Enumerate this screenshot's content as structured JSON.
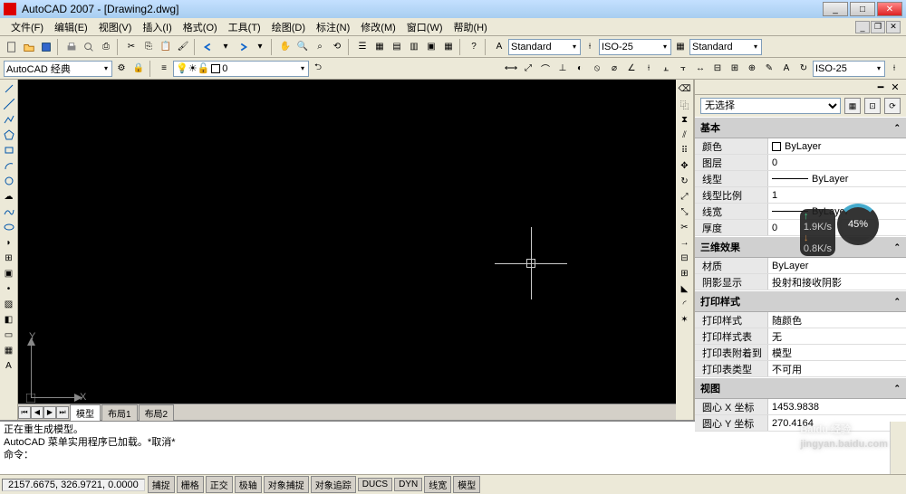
{
  "title": "AutoCAD 2007 - [Drawing2.dwg]",
  "menu": [
    "文件(F)",
    "编辑(E)",
    "视图(V)",
    "插入(I)",
    "格式(O)",
    "工具(T)",
    "绘图(D)",
    "标注(N)",
    "修改(M)",
    "窗口(W)",
    "帮助(H)"
  ],
  "workspace_combo": "AutoCAD 经典",
  "layer_combo": "0",
  "style1": "Standard",
  "style2": "ISO-25",
  "style3": "Standard",
  "style4": "ISO-25",
  "model_tabs": {
    "active": "模型",
    "inactive": [
      "布局1",
      "布局2"
    ]
  },
  "cmd": {
    "line1": "正在重生成模型。",
    "line2": "AutoCAD 菜单实用程序已加载。*取消*",
    "line3": "命令："
  },
  "status": {
    "coord": "2157.6675, 326.9721, 0.0000",
    "buttons": [
      "捕捉",
      "栅格",
      "正交",
      "极轴",
      "对象捕捉",
      "对象追踪",
      "DUCS",
      "DYN",
      "线宽",
      "模型"
    ]
  },
  "props": {
    "selector": "无选择",
    "groups": {
      "basic": {
        "title": "基本",
        "color_k": "颜色",
        "color_v": "ByLayer",
        "layer_k": "图层",
        "layer_v": "0",
        "ltype_k": "线型",
        "ltype_v": "ByLayer",
        "lscale_k": "线型比例",
        "lscale_v": "1",
        "lweight_k": "线宽",
        "lweight_v": "ByLayer",
        "thick_k": "厚度",
        "thick_v": "0"
      },
      "threed": {
        "title": "三维效果",
        "mat_k": "材质",
        "mat_v": "ByLayer",
        "shadow_k": "阴影显示",
        "shadow_v": "投射和接收阴影"
      },
      "print": {
        "title": "打印样式",
        "ps_k": "打印样式",
        "ps_v": "随颜色",
        "pst_k": "打印样式表",
        "pst_v": "无",
        "psa_k": "打印表附着到",
        "psa_v": "模型",
        "pstt_k": "打印表类型",
        "pstt_v": "不可用"
      },
      "view": {
        "title": "视图",
        "cx_k": "圆心 X 坐标",
        "cx_v": "1453.9838",
        "cy_k": "圆心 Y 坐标",
        "cy_v": "270.4164"
      }
    }
  },
  "ucs": {
    "x": "X",
    "y": "Y"
  },
  "gauge": {
    "pct": "45%",
    "up": "1.9K/s",
    "dn": "0.8K/s"
  },
  "watermark": {
    "brand": "Baidu 经验",
    "url": "jingyan.baidu.com"
  }
}
